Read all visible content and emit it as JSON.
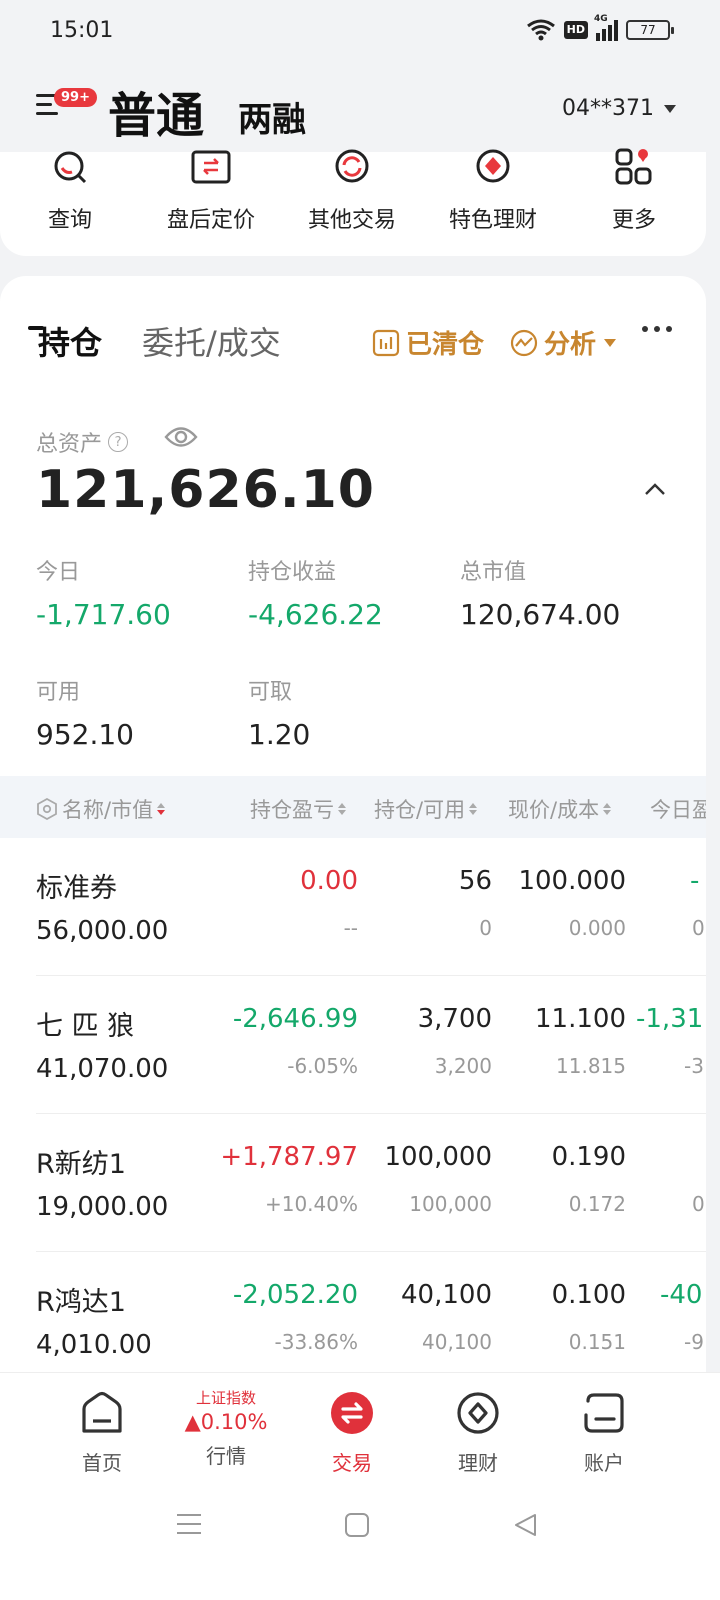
{
  "status_bar": {
    "time": "15:01",
    "hd": "HD",
    "network": "4G",
    "battery": "77"
  },
  "header": {
    "badge": "99+",
    "title": "普通",
    "subtitle": "两融",
    "account": "04**371"
  },
  "quick_actions": [
    {
      "label": "查询",
      "icon": "search-icon"
    },
    {
      "label": "盘后定价",
      "icon": "transfer-card-icon"
    },
    {
      "label": "其他交易",
      "icon": "refresh-icon"
    },
    {
      "label": "特色理财",
      "icon": "diamond-icon"
    },
    {
      "label": "更多",
      "icon": "grid-icon"
    }
  ],
  "tabs": {
    "positions": "持仓",
    "orders": "委托/成交"
  },
  "tools": {
    "cleared": "已清仓",
    "analysis": "分析"
  },
  "summary": {
    "total_assets_label": "总资产",
    "help_symbol": "?",
    "total_assets": "121,626.10",
    "today_label": "今日",
    "today_value": "-1,717.60",
    "position_pnl_label": "持仓收益",
    "position_pnl_value": "-4,626.22",
    "market_value_label": "总市值",
    "market_value": "120,674.00",
    "available_label": "可用",
    "available_value": "952.10",
    "withdrawable_label": "可取",
    "withdrawable_value": "1.20"
  },
  "table": {
    "headers": [
      "名称/市值",
      "持仓盈亏",
      "持仓/可用",
      "现价/成本",
      "今日盈"
    ],
    "rows": [
      {
        "name": "标准券",
        "market_value": "56,000.00",
        "pnl": "0.00",
        "pnl_pct": "--",
        "position": "56",
        "available": "0",
        "price": "100.000",
        "cost": "0.000",
        "today": "-",
        "today_pct": "0",
        "pnl_color": "#e0313b"
      },
      {
        "name": "七 匹 狼",
        "market_value": "41,070.00",
        "pnl": "-2,646.99",
        "pnl_pct": "-6.05%",
        "position": "3,700",
        "available": "3,200",
        "price": "11.100",
        "cost": "11.815",
        "today": "-1,31",
        "today_pct": "-3",
        "pnl_color": "#14a86a"
      },
      {
        "name": "R新纺1",
        "market_value": "19,000.00",
        "pnl": "+1,787.97",
        "pnl_pct": "+10.40%",
        "position": "100,000",
        "available": "100,000",
        "price": "0.190",
        "cost": "0.172",
        "today": "",
        "today_pct": "0",
        "pnl_color": "#e0313b"
      },
      {
        "name": "R鸿达1",
        "market_value": "4,010.00",
        "pnl": "-2,052.20",
        "pnl_pct": "-33.86%",
        "position": "40,100",
        "available": "40,100",
        "price": "0.100",
        "cost": "0.151",
        "today": "-40",
        "today_pct": "-9",
        "pnl_color": "#14a86a"
      }
    ]
  },
  "bottom_nav": {
    "home": "首页",
    "market": "行情",
    "index_name": "上证指数",
    "index_change": "▲0.10%",
    "trade": "交易",
    "wealth": "理财",
    "account": "账户"
  },
  "colors": {
    "up": "#e0313b",
    "down": "#14a86a",
    "accent": "#c8862f"
  }
}
